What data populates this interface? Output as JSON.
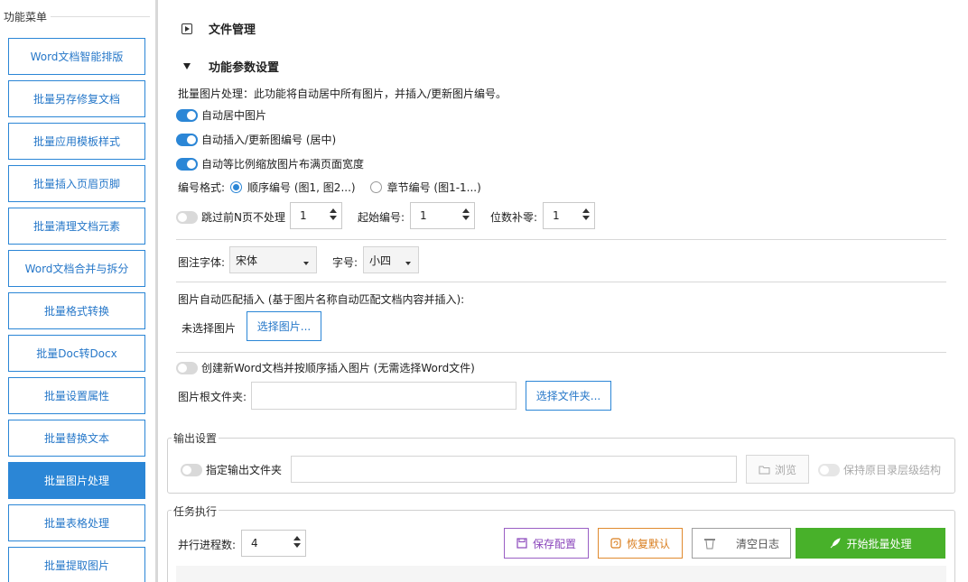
{
  "sidebar": {
    "title": "功能菜单",
    "items": [
      {
        "label": "Word文档智能排版"
      },
      {
        "label": "批量另存修复文档"
      },
      {
        "label": "批量应用模板样式"
      },
      {
        "label": "批量插入页眉页脚"
      },
      {
        "label": "批量清理文档元素"
      },
      {
        "label": "Word文档合并与拆分"
      },
      {
        "label": "批量格式转换"
      },
      {
        "label": "批量Doc转Docx"
      },
      {
        "label": "批量设置属性"
      },
      {
        "label": "批量替换文本"
      },
      {
        "label": "批量图片处理"
      },
      {
        "label": "批量表格处理"
      },
      {
        "label": "批量提取图片"
      }
    ],
    "active_index": 10
  },
  "file_section": {
    "label": "文件管理"
  },
  "params_section": {
    "label": "功能参数设置"
  },
  "description": "批量图片处理：此功能将自动居中所有图片，并插入/更新图片编号。",
  "options": {
    "center": "自动居中图片",
    "numbering": "自动插入/更新图编号 (居中)",
    "scale": "自动等比例缩放图片布满页面宽度"
  },
  "numbering_format": {
    "label": "编号格式:",
    "sequential": "顺序编号 (图1, 图2...)",
    "chapter": "章节编号 (图1-1...)"
  },
  "skip": {
    "label": "跳过前N页不处理",
    "value": "1"
  },
  "start_number": {
    "label": "起始编号:",
    "value": "1"
  },
  "padding": {
    "label": "位数补零:",
    "value": "1"
  },
  "caption_font": {
    "label": "图注字体:",
    "value": "宋体"
  },
  "font_size": {
    "label": "字号:",
    "value": "小四"
  },
  "auto_match": {
    "title": "图片自动匹配插入 (基于图片名称自动匹配文档内容并插入):",
    "status": "未选择图片",
    "button": "选择图片..."
  },
  "create_new": {
    "label": "创建新Word文档并按顺序插入图片 (无需选择Word文件)"
  },
  "root_folder": {
    "label": "图片根文件夹:",
    "button": "选择文件夹..."
  },
  "output": {
    "title": "输出设置",
    "specify": "指定输出文件夹",
    "browse": "浏览",
    "keep_structure": "保持原目录层级结构"
  },
  "task": {
    "title": "任务执行",
    "parallel_label": "并行进程数:",
    "parallel_value": "4",
    "save": "保存配置",
    "restore": "恢复默认",
    "clear": "清空日志",
    "start": "开始批量处理"
  },
  "colors": {
    "accent": "#2b86d6",
    "start": "#48b12a",
    "save": "#8a45bb",
    "restore": "#d97d1d"
  }
}
